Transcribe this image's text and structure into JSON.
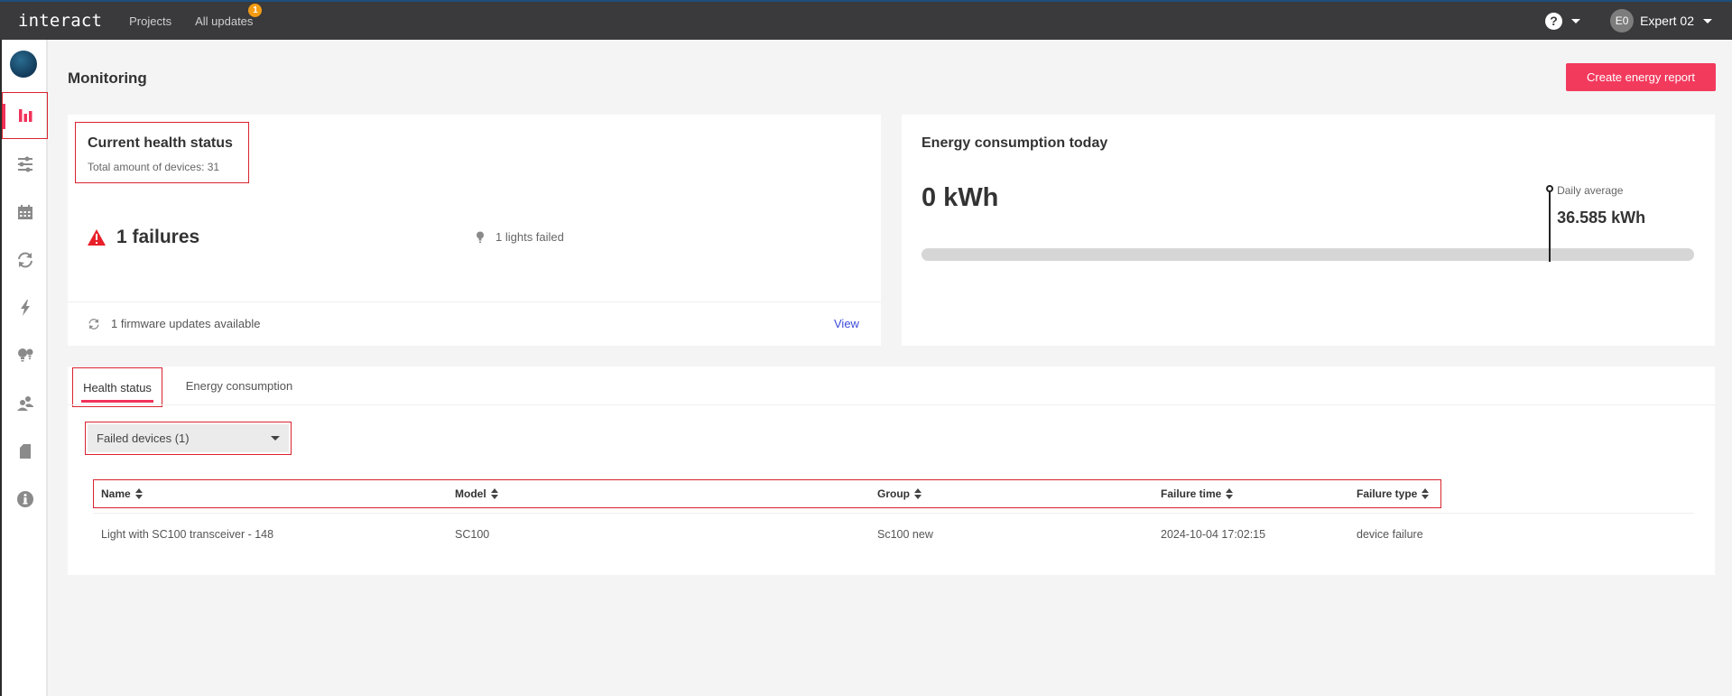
{
  "topbar": {
    "logo": "interact",
    "nav": [
      {
        "label": "Projects"
      },
      {
        "label": "All updates",
        "badge": "1"
      }
    ],
    "help_icon": "question-circle-icon",
    "user": {
      "initials": "E0",
      "name": "Expert 02"
    }
  },
  "sidebar": {
    "items": [
      {
        "name": "monitoring",
        "icon": "bar-chart-icon",
        "active": true
      },
      {
        "name": "controls",
        "icon": "sliders-icon"
      },
      {
        "name": "schedules",
        "icon": "calendar-icon"
      },
      {
        "name": "updates",
        "icon": "refresh-icon"
      },
      {
        "name": "energy",
        "icon": "lightning-icon"
      },
      {
        "name": "lights",
        "icon": "bulbs-icon"
      },
      {
        "name": "users",
        "icon": "users-icon"
      },
      {
        "name": "documents",
        "icon": "document-icon"
      },
      {
        "name": "info",
        "icon": "info-icon"
      }
    ],
    "colors": {
      "active": "#f0325a",
      "inactive": "#8a8a8a"
    }
  },
  "page": {
    "title": "Monitoring",
    "create_report_label": "Create energy report"
  },
  "health": {
    "title": "Current health status",
    "subtitle": "Total amount of devices: 31",
    "failures": "1 failures",
    "lights_failed": "1 lights failed",
    "firmware": "1 firmware updates available",
    "view_label": "View"
  },
  "energy": {
    "title": "Energy consumption today",
    "value": "0 kWh",
    "today_kwh": 0,
    "daily_average_label": "Daily average",
    "daily_average_value": "36.585 kWh",
    "daily_average_fraction_of_bar": 0.812
  },
  "tabs": [
    {
      "label": "Health status",
      "active": true
    },
    {
      "label": "Energy consumption"
    }
  ],
  "filter": {
    "selected": "Failed devices (1)"
  },
  "table": {
    "columns": [
      "Name",
      "Model",
      "Group",
      "Failure time",
      "Failure type"
    ],
    "rows": [
      [
        "Light with SC100 transceiver - 148",
        "SC100",
        "Sc100 new",
        "2024-10-04 17:02:15",
        "device failure"
      ]
    ]
  },
  "colors": {
    "accent": "#f23a5d",
    "topbar": "#3a393b",
    "link": "#3b4bdb",
    "badge": "#f39c12",
    "warning": "#e8202a"
  }
}
